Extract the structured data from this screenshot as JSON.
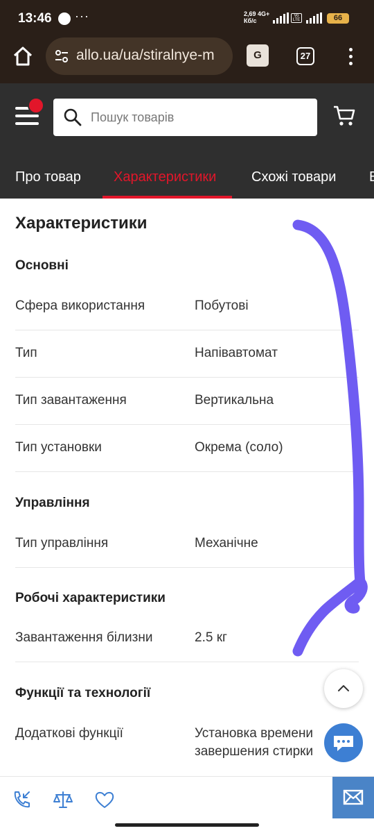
{
  "status_bar": {
    "time": "13:46",
    "more": "···",
    "net_speed": "2,69",
    "net_unit": "Кб/с",
    "network": "4G+",
    "lte_label": "Vo LTE",
    "battery": "66"
  },
  "browser": {
    "url": "allo.ua/ua/stiralnye-m",
    "translate_glyph": "G",
    "tabs_count": "27"
  },
  "site": {
    "search_placeholder": "Пошук товарів",
    "accent_color": "#e2162a",
    "tabs": [
      {
        "label": "Про товар"
      },
      {
        "label": "Характеристики",
        "active": true
      },
      {
        "label": "Схожі товари"
      },
      {
        "label": "В"
      }
    ]
  },
  "specs": {
    "title": "Характеристики",
    "groups": [
      {
        "title": "Основні",
        "rows": [
          {
            "key": "Сфера використання",
            "value": "Побутові"
          },
          {
            "key": "Тип",
            "value": "Напівавтомат"
          },
          {
            "key": "Тип завантаження",
            "value": "Вертикальна"
          },
          {
            "key": "Тип установки",
            "value": "Окрема (соло)"
          }
        ]
      },
      {
        "title": "Управління",
        "rows": [
          {
            "key": "Тип управління",
            "value": "Механічне"
          }
        ]
      },
      {
        "title": "Робочі характеристики",
        "rows": [
          {
            "key": "Завантаження білизни",
            "value": "2.5 кг"
          }
        ]
      },
      {
        "title": "Функції та технології",
        "rows": [
          {
            "key": "Додаткові функції",
            "value": "Установка времени завершения стирки"
          }
        ]
      }
    ]
  },
  "annotation": {
    "color": "#6f5cf2"
  }
}
